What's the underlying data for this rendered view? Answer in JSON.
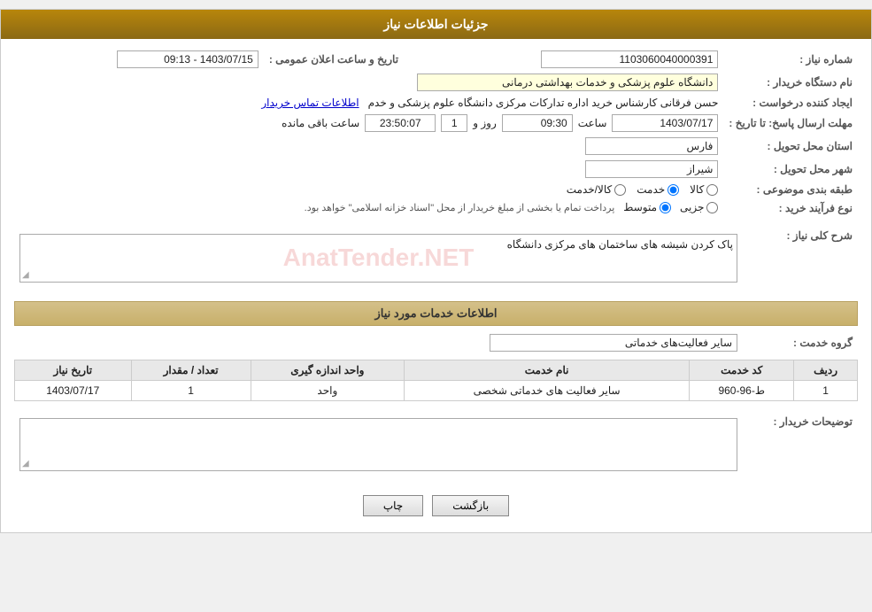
{
  "header": {
    "title": "جزئیات اطلاعات نیاز"
  },
  "fields": {
    "need_number_label": "شماره نیاز :",
    "need_number_value": "1103060040000391",
    "buyer_org_label": "نام دستگاه خریدار :",
    "buyer_org_value": "دانشگاه علوم پزشکی و خدمات بهداشتی درمانی",
    "creator_label": "ایجاد کننده درخواست :",
    "creator_value": "حسن فرقانی کارشناس خرید اداره تدارکات مرکزی دانشگاه علوم پزشکی و خدم",
    "creator_link": "اطلاعات تماس خریدار",
    "response_deadline_label": "مهلت ارسال پاسخ: تا تاریخ :",
    "announce_datetime_label": "تاریخ و ساعت اعلان عمومی :",
    "announce_datetime_value": "1403/07/15 - 09:13",
    "response_date": "1403/07/17",
    "response_time": "09:30",
    "response_days": "1",
    "response_remaining": "23:50:07",
    "province_label": "استان محل تحویل :",
    "province_value": "فارس",
    "city_label": "شهر محل تحویل :",
    "city_value": "شیراز",
    "category_label": "طبقه بندی موضوعی :",
    "category_options": [
      "کالا",
      "خدمت",
      "کالا/خدمت"
    ],
    "category_selected": "خدمت",
    "process_type_label": "نوع فرآیند خرید :",
    "process_options": [
      "جزیی",
      "متوسط"
    ],
    "process_selected": "متوسط",
    "process_note": "پرداخت تمام یا بخشی از مبلغ خریدار از محل \"اسناد خزانه اسلامی\" خواهد بود.",
    "need_desc_label": "شرح کلی نیاز :",
    "need_desc_value": "پاک کردن شیشه های ساختمان های مرکزی دانشگاه",
    "services_section_title": "اطلاعات خدمات مورد نیاز",
    "service_group_label": "گروه خدمت :",
    "service_group_value": "سایر فعالیت‌های خدماتی",
    "services_table": {
      "columns": [
        "ردیف",
        "کد خدمت",
        "نام خدمت",
        "واحد اندازه گیری",
        "تعداد / مقدار",
        "تاریخ نیاز"
      ],
      "rows": [
        {
          "row_num": "1",
          "service_code": "ط-96-960",
          "service_name": "سایر فعالیت های خدماتی شخصی",
          "unit": "واحد",
          "quantity": "1",
          "date": "1403/07/17"
        }
      ]
    },
    "buyer_notes_label": "توضیحات خریدار :",
    "buyer_notes_value": ""
  },
  "buttons": {
    "print_label": "چاپ",
    "back_label": "بازگشت"
  },
  "icons": {
    "resize": "◢"
  }
}
